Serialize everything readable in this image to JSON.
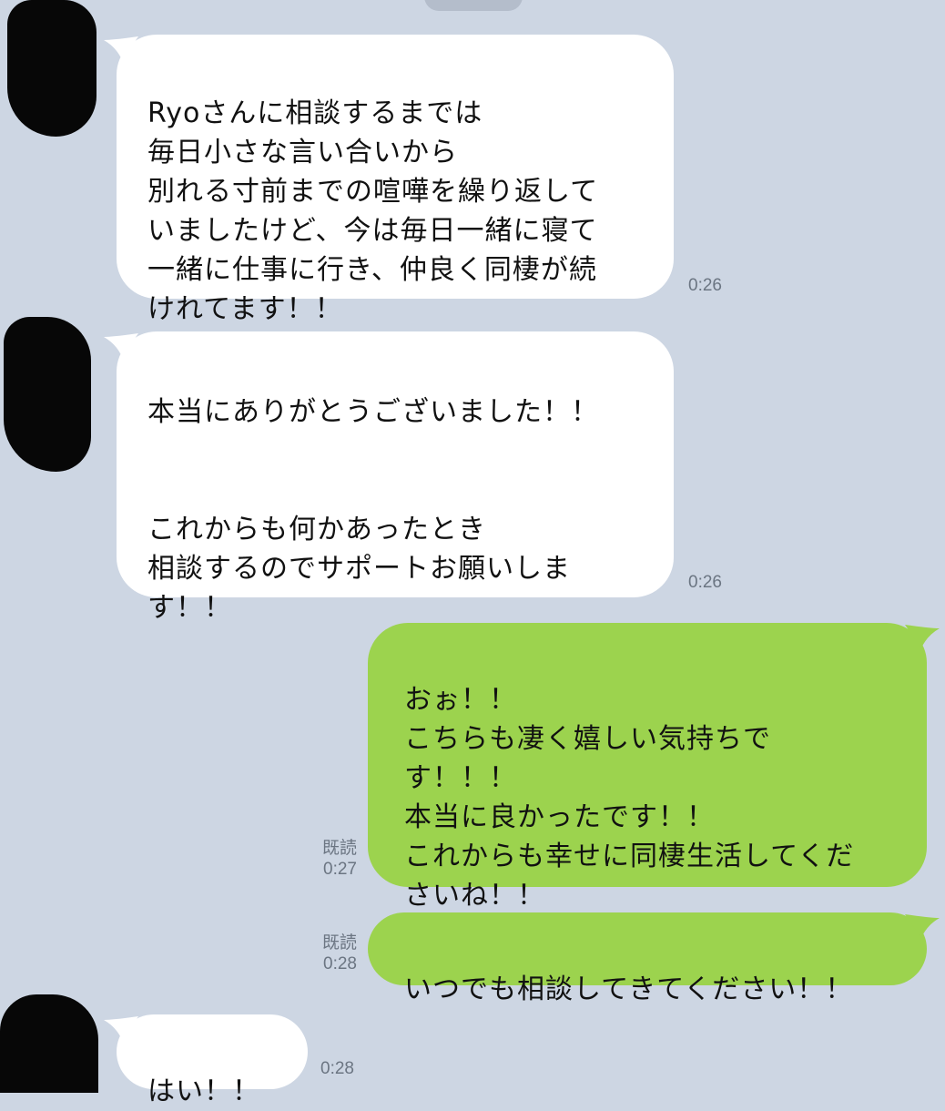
{
  "messages": [
    {
      "side": "in",
      "text": "Ryoさんに相談するまでは\n毎日小さな言い合いから\n別れる寸前までの喧嘩を繰り返して\nいましたけど、今は毎日一緒に寝て\n一緒に仕事に行き、仲良く同棲が続\nけれてます！！",
      "time": "0:26"
    },
    {
      "side": "in",
      "text": "本当にありがとうございました！！\n\n\nこれからも何かあったとき\n相談するのでサポートお願いしま\nす！！",
      "time": "0:26"
    },
    {
      "side": "out",
      "text": "おぉ！！\nこちらも凄く嬉しい気持ちで\nす！！！\n本当に良かったです！！\nこれからも幸せに同棲生活してくだ\nさいね！！",
      "read": "既読",
      "time": "0:27"
    },
    {
      "side": "out",
      "text": "いつでも相談してきてください！！",
      "read": "既読",
      "time": "0:28"
    },
    {
      "side": "in",
      "text": "はい！！",
      "time": "0:28"
    }
  ],
  "colors": {
    "background": "#cdd6e3",
    "incoming_bubble": "#ffffff",
    "outgoing_bubble": "#9cd34e",
    "timestamp": "#6b7582"
  }
}
